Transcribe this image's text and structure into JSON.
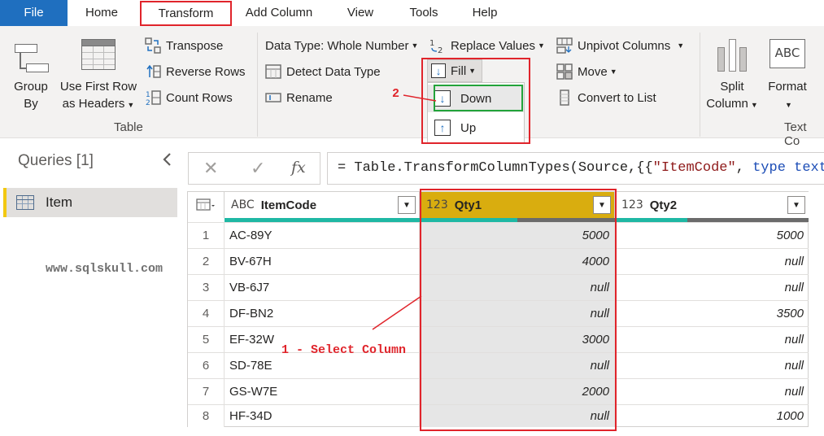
{
  "menu": {
    "tabs": [
      "File",
      "Home",
      "Transform",
      "Add Column",
      "View",
      "Tools",
      "Help"
    ]
  },
  "ribbon": {
    "table_group": {
      "label": "Table",
      "group_by": [
        "Group",
        "By"
      ],
      "use_first_row": [
        "Use First Row",
        "as Headers"
      ],
      "transpose": "Transpose",
      "reverse_rows": "Reverse Rows",
      "count_rows": "Count Rows"
    },
    "any_column_group": {
      "data_type": "Data Type: Whole Number",
      "detect_data_type": "Detect Data Type",
      "rename": "Rename",
      "replace_values": "Replace Values",
      "fill": "Fill",
      "fill_down": "Down",
      "fill_up": "Up",
      "unpivot_columns": "Unpivot Columns",
      "move": "Move",
      "convert_to_list": "Convert to List"
    },
    "text_group": {
      "split_column": [
        "Split",
        "Column"
      ],
      "format": "Format",
      "label": "Text Co"
    }
  },
  "annotations": {
    "step1": "1 - Select Column",
    "step2": "2"
  },
  "queries": {
    "title": "Queries [1]",
    "items": [
      "Item"
    ]
  },
  "watermark": "www.sqlskull.com",
  "formula": {
    "prefix": "= Table.TransformColumnTypes(Source,{{",
    "string": "\"ItemCode\"",
    "sep": ", ",
    "keyword": "type text",
    "suffix": "}"
  },
  "grid": {
    "columns": [
      {
        "type_icon": "ABC",
        "name": "ItemCode"
      },
      {
        "type_icon": "123",
        "name": "Qty1"
      },
      {
        "type_icon": "123",
        "name": "Qty2"
      }
    ],
    "rows": [
      {
        "n": "1",
        "code": "AC-89Y",
        "qty1": "5000",
        "qty2": "5000"
      },
      {
        "n": "2",
        "code": "BV-67H",
        "qty1": "4000",
        "qty2": "null"
      },
      {
        "n": "3",
        "code": "VB-6J7",
        "qty1": "null",
        "qty2": "null"
      },
      {
        "n": "4",
        "code": "DF-BN2",
        "qty1": "null",
        "qty2": "3500"
      },
      {
        "n": "5",
        "code": "EF-32W",
        "qty1": "3000",
        "qty2": "null"
      },
      {
        "n": "6",
        "code": "SD-78E",
        "qty1": "null",
        "qty2": "null"
      },
      {
        "n": "7",
        "code": "GS-W7E",
        "qty1": "2000",
        "qty2": "null"
      },
      {
        "n": "8",
        "code": "HF-34D",
        "qty1": "null",
        "qty2": "1000"
      }
    ]
  },
  "colors": {
    "file_tab": "#1f6fbf",
    "selected_header": "#d9ad0f",
    "quality_valid": "#1fb8a4",
    "quality_empty": "#6b6b6b",
    "annotation_red": "#e0242b",
    "annotation_green": "#22a33a"
  }
}
